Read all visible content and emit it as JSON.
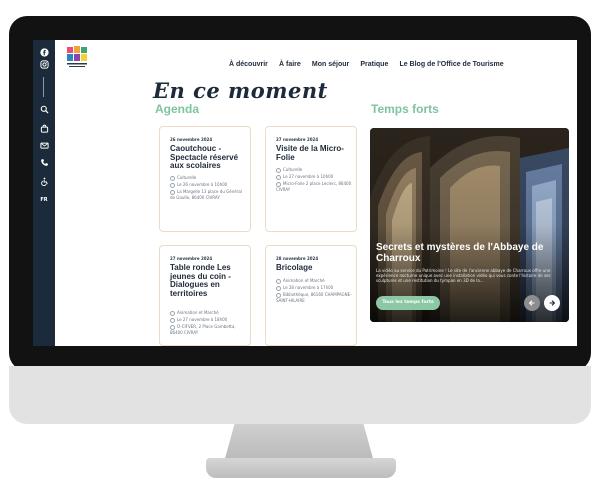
{
  "sidebar": {
    "icons": [
      "facebook-icon",
      "instagram-icon",
      "search-icon",
      "shopping-bag-icon",
      "mail-icon",
      "phone-icon",
      "accessibility-icon"
    ],
    "language": "FR"
  },
  "nav": {
    "items": [
      "À découvrir",
      "À faire",
      "Mon séjour",
      "Pratique",
      "Le Blog de l'Office de Tourisme"
    ]
  },
  "main": {
    "heading": "En ce moment",
    "agenda_title": "Agenda",
    "temps_forts_title": "Temps forts"
  },
  "agenda": [
    {
      "date": "26 novembre 2024",
      "title": "Caoutchouc - Spectacle réservé aux scolaires",
      "meta": [
        "Culturelle",
        "Le 26 novembre à 10h00",
        "La Margelle 13 place du Général de Gaulle, 86400 CIVRAY"
      ]
    },
    {
      "date": "27 novembre 2024",
      "title": "Visite de la Micro-Folie",
      "meta": [
        "Culturelle",
        "Le 27 novembre à 10h00",
        "Micro-Folie 2 place Leclerc, 86400 CIVRAY"
      ]
    },
    {
      "date": "27 novembre 2024",
      "title": "Table ronde Les jeunes du coin - Dialogues en territoires",
      "meta": [
        "Animation et Marché",
        "Le 27 novembre à 18h00",
        "O-CIFVER, 2 Place Gambetta, 86400 CIVRAY"
      ]
    },
    {
      "date": "28 novembre 2024",
      "title": "Bricolage",
      "meta": [
        "Animation et Marché",
        "Le 28 novembre à 17h00",
        "Bibliothèque, 86160 CHAMPAGNE-SAINT-HILAIRE"
      ]
    }
  ],
  "feature": {
    "title": "Secrets et mystères de l'Abbaye de Charroux",
    "description": "La vidéo au service du Patrimoine ! Le site de l'ancienne abbaye de Charroux offre une expérience nocturne unique avec une installation vidéo qui vous conte l'histoire de ses sculptures et une restitution du tympan en 3D de la...",
    "button_label": "Tous les temps forts",
    "prev_icon": "arrow-left-icon",
    "next_icon": "arrow-right-icon"
  }
}
